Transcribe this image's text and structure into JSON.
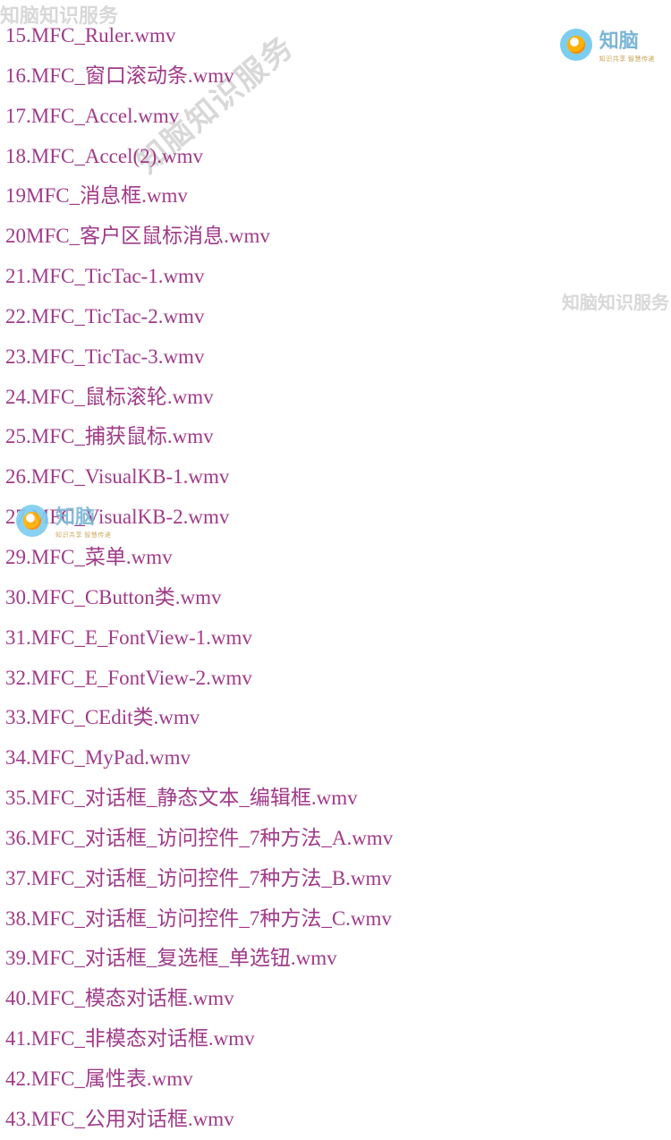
{
  "watermarks": {
    "topLeft": "知脑知识服务",
    "diagonal": "知脑知识服务",
    "right": "知脑知识服务"
  },
  "brand": {
    "name": "知脑",
    "sub": "知识共享 智慧传递"
  },
  "files": [
    "15.MFC_Ruler.wmv",
    "16.MFC_窗口滚动条.wmv",
    "17.MFC_Accel.wmv",
    "18.MFC_Accel(2).wmv",
    "19MFC_消息框.wmv",
    "20MFC_客户区鼠标消息.wmv",
    "21.MFC_TicTac-1.wmv",
    "22.MFC_TicTac-2.wmv",
    "23.MFC_TicTac-3.wmv",
    "24.MFC_鼠标滚轮.wmv",
    "25.MFC_捕获鼠标.wmv",
    "26.MFC_VisualKB-1.wmv",
    "27.MFC_VisualKB-2.wmv",
    "29.MFC_菜单.wmv",
    "30.MFC_CButton类.wmv",
    "31.MFC_E_FontView-1.wmv",
    "32.MFC_E_FontView-2.wmv",
    "33.MFC_CEdit类.wmv",
    "34.MFC_MyPad.wmv",
    "35.MFC_对话框_静态文本_编辑框.wmv",
    "36.MFC_对话框_访问控件_7种方法_A.wmv",
    "37.MFC_对话框_访问控件_7种方法_B.wmv",
    "38.MFC_对话框_访问控件_7种方法_C.wmv",
    "39.MFC_对话框_复选框_单选钮.wmv",
    "40.MFC_模态对话框.wmv",
    "41.MFC_非模态对话框.wmv",
    "42.MFC_属性表.wmv",
    "43.MFC_公用对话框.wmv"
  ]
}
